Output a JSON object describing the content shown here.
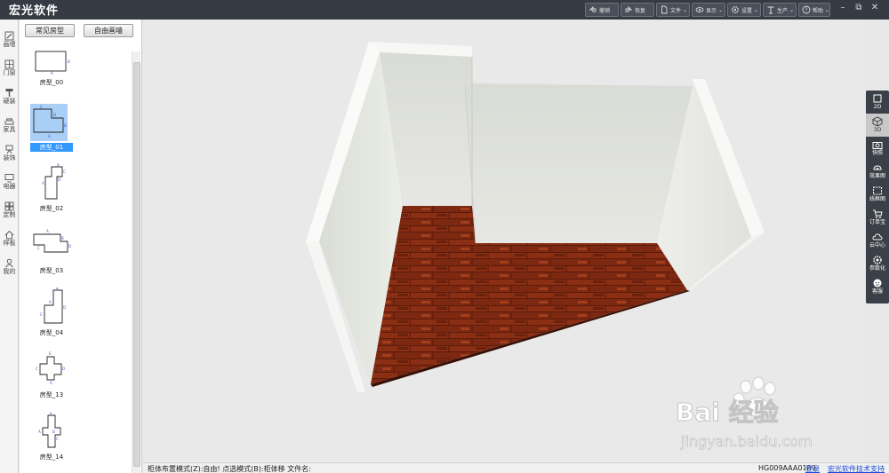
{
  "app": {
    "title": "宏光软件"
  },
  "toolbar": [
    {
      "icon": "undo-icon",
      "label": "撤销"
    },
    {
      "icon": "redo-icon",
      "label": "恢复"
    },
    {
      "icon": "file-icon",
      "label": "文件"
    },
    {
      "icon": "eye-icon",
      "label": "显示"
    },
    {
      "icon": "gear-icon",
      "label": "设置"
    },
    {
      "icon": "produce-icon",
      "label": "生产"
    },
    {
      "icon": "help-icon",
      "label": "帮助"
    }
  ],
  "categories": [
    {
      "icon": "pencil-icon",
      "label": "画墙"
    },
    {
      "icon": "door-window-icon",
      "label": "门窗"
    },
    {
      "icon": "paint-roller-icon",
      "label": "硬装"
    },
    {
      "icon": "sofa-icon",
      "label": "家具"
    },
    {
      "icon": "decor-icon",
      "label": "装饰"
    },
    {
      "icon": "tv-icon",
      "label": "电器"
    },
    {
      "icon": "grid-icon",
      "label": "定制"
    },
    {
      "icon": "house-icon",
      "label": "样板"
    },
    {
      "icon": "user-icon",
      "label": "我的"
    }
  ],
  "room_tabs": {
    "common": "常见房型",
    "free": "自由画墙"
  },
  "rooms": [
    {
      "label": "房型_00",
      "selected": false
    },
    {
      "label": "房型_01",
      "selected": true
    },
    {
      "label": "房型_02",
      "selected": false
    },
    {
      "label": "房型_03",
      "selected": false
    },
    {
      "label": "房型_04",
      "selected": false
    },
    {
      "label": "房型_13",
      "selected": false
    },
    {
      "label": "房型_14",
      "selected": false
    }
  ],
  "right_tools": [
    {
      "icon": "2d-icon",
      "label": "2D",
      "active": false
    },
    {
      "icon": "3d-icon",
      "label": "3D",
      "active": true
    },
    {
      "icon": "camera-icon",
      "label": "快照",
      "active": false
    },
    {
      "icon": "render-icon",
      "label": "效果图",
      "active": false
    },
    {
      "icon": "wireframe-icon",
      "label": "线框图",
      "active": false
    },
    {
      "icon": "cart-icon",
      "label": "订单宝",
      "active": false
    },
    {
      "icon": "cloud-icon",
      "label": "云中心",
      "active": false
    },
    {
      "icon": "param-icon",
      "label": "参数化",
      "active": false
    },
    {
      "icon": "service-icon",
      "label": "客服",
      "active": false
    }
  ],
  "status": {
    "left": "柜体布置模式(Z):自由!  点选模式(B):柜体移  文件名:",
    "code": "HG009AAA0189",
    "login": "登录",
    "support": "宏光软件技术支持"
  },
  "watermark": {
    "brand": "Bai  经验",
    "url": "jingyan.baidu.com"
  },
  "colors": {
    "titlebar": "#353a43",
    "accent_selected": "#3399ff",
    "floor": "#8a2e14",
    "wall": "#e7e9e4",
    "link": "#1a4bd6"
  }
}
